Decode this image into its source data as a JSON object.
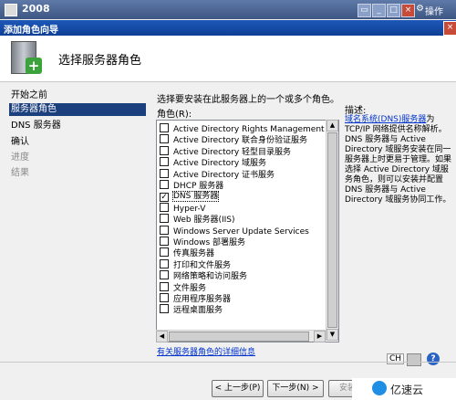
{
  "host": {
    "title": "2008",
    "options_label": "操作"
  },
  "wizard": {
    "title": "添加角色向导",
    "page_title": "选择服务器角色",
    "nav": [
      "开始之前",
      "服务器角色",
      "DNS 服务器",
      "确认",
      "进度",
      "结果"
    ],
    "instruction": "选择要安装在此服务器上的一个或多个角色。",
    "roles_label": "角色(R):",
    "roles": [
      {
        "name": "Active Directory Rights Management Servi",
        "checked": false
      },
      {
        "name": "Active Directory 联合身份验证服务",
        "checked": false
      },
      {
        "name": "Active Directory 轻型目录服务",
        "checked": false
      },
      {
        "name": "Active Directory 域服务",
        "checked": false
      },
      {
        "name": "Active Directory 证书服务",
        "checked": false
      },
      {
        "name": "DHCP 服务器",
        "checked": false
      },
      {
        "name": "DNS 服务器",
        "checked": true
      },
      {
        "name": "Hyper-V",
        "checked": false
      },
      {
        "name": "Web 服务器(IIS)",
        "checked": false
      },
      {
        "name": "Windows Server Update Services",
        "checked": false
      },
      {
        "name": "Windows 部署服务",
        "checked": false
      },
      {
        "name": "传真服务器",
        "checked": false
      },
      {
        "name": "打印和文件服务",
        "checked": false
      },
      {
        "name": "网络策略和访问服务",
        "checked": false
      },
      {
        "name": "文件服务",
        "checked": false
      },
      {
        "name": "应用程序服务器",
        "checked": false
      },
      {
        "name": "远程桌面服务",
        "checked": false
      }
    ],
    "desc_label": "描述:",
    "desc_link": "域名系统(DNS)服务器",
    "desc_text": "为 TCP/IP 网络提供名称解析。DNS 服务器与 Active Directory 域服务安装在同一服务器上时更易于管理。如果选择 Active Directory 域服务角色，则可以安装并配置 DNS 服务器与 Active Directory 域服务协同工作。",
    "more_link": "有关服务器角色的详细信息",
    "buttons": {
      "back": "< 上一步(P)",
      "next": "下一步(N) >",
      "install": "安装"
    }
  },
  "langbar": {
    "ime": "CH"
  },
  "watermark": "亿速云"
}
